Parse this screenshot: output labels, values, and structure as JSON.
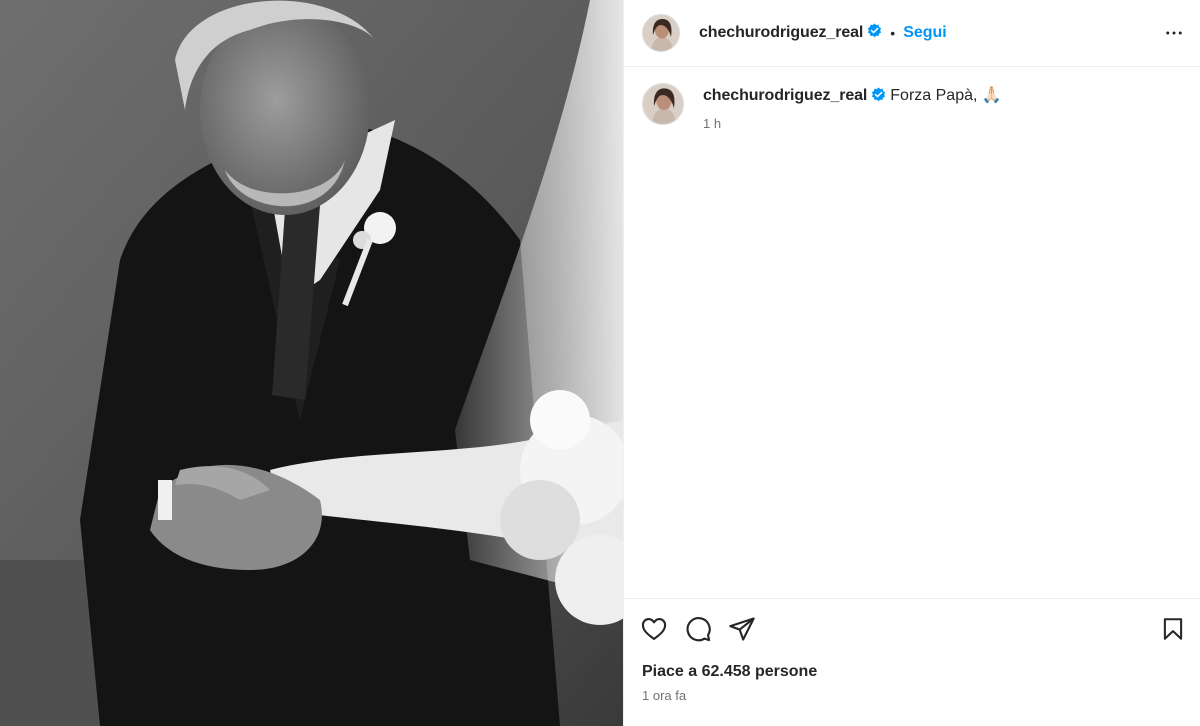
{
  "post": {
    "photo": {
      "alt_icon": "photo-wedding-black-and-white"
    },
    "header": {
      "username": "chechurodriguez_real",
      "verified_icon": "verified-badge-icon",
      "separator": "•",
      "follow_label": "Segui",
      "more_icon": "more-options-icon"
    },
    "caption": {
      "username": "chechurodriguez_real",
      "text": "Forza Papà, 🙏🏻",
      "time": "1 h"
    },
    "actions": {
      "like_icon": "heart-icon",
      "comment_icon": "comment-icon",
      "share_icon": "share-icon",
      "save_icon": "bookmark-icon"
    },
    "likes_text": "Piace a 62.458 persone",
    "posted_ago": "1 ora fa",
    "colors": {
      "accent": "#0095f6",
      "verified": "#0095f6",
      "text": "#262626",
      "muted": "#737373",
      "border": "#efefef"
    }
  }
}
